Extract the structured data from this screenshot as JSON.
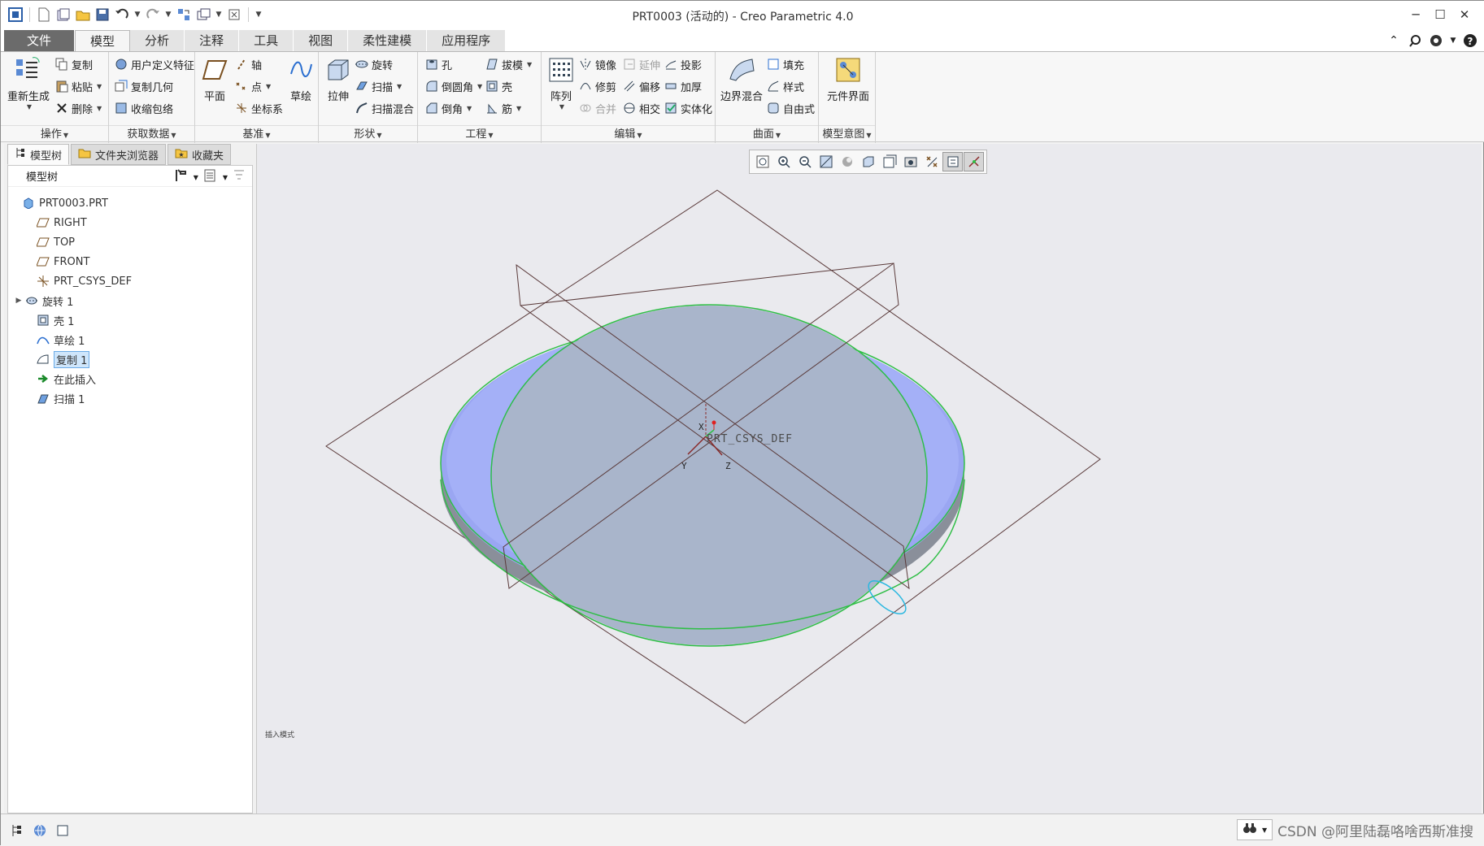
{
  "window": {
    "title": "PRT0003 (活动的) - Creo Parametric 4.0",
    "controls": [
      "minimize-icon",
      "maximize-icon",
      "close-icon"
    ]
  },
  "quick_access": [
    "app-logo-icon",
    "new-icon",
    "open-folder-icon",
    "open-icon",
    "save-icon",
    "undo-icon",
    "redo-icon",
    "regenerate-icon",
    "windows-icon",
    "close-window-icon",
    "customize-icon"
  ],
  "tabs": [
    {
      "label": "文件"
    },
    {
      "label": "模型"
    },
    {
      "label": "分析"
    },
    {
      "label": "注释"
    },
    {
      "label": "工具"
    },
    {
      "label": "视图"
    },
    {
      "label": "柔性建模"
    },
    {
      "label": "应用程序"
    }
  ],
  "ribbon": {
    "operations": {
      "footer": "操作",
      "regenerate": "重新生成",
      "copy": "复制",
      "paste": "粘贴",
      "delete": "删除"
    },
    "get_data": {
      "footer": "获取数据",
      "udf": "用户定义特征",
      "copy_geom": "复制几何",
      "shrinkwrap": "收缩包络"
    },
    "datum": {
      "footer": "基准",
      "plane": "平面",
      "axis": "轴",
      "point": "点",
      "csys": "坐标系",
      "sketch": "草绘"
    },
    "shapes": {
      "footer": "形状",
      "extrude": "拉伸",
      "revolve": "旋转",
      "sweep": "扫描",
      "swept_blend": "扫描混合"
    },
    "engineering": {
      "footer": "工程",
      "hole": "孔",
      "round": "倒圆角",
      "chamfer": "倒角",
      "draft": "拔模",
      "shell": "壳",
      "rib": "筋"
    },
    "editing": {
      "footer": "编辑",
      "pattern": "阵列",
      "mirror": "镜像",
      "extend": "延伸",
      "project": "投影",
      "trim": "修剪",
      "offset": "偏移",
      "thicken": "加厚",
      "merge": "合并",
      "intersect": "相交",
      "solidify": "实体化"
    },
    "surfaces": {
      "footer": "曲面",
      "boundary_blend": "边界混合",
      "fill": "填充",
      "style": "样式",
      "freestyle": "自由式"
    },
    "model_intent": {
      "footer": "模型意图",
      "component_interface": "元件界面"
    }
  },
  "panel": {
    "tabs": [
      {
        "label": "模型树"
      },
      {
        "label": "文件夹浏览器"
      },
      {
        "label": "收藏夹"
      }
    ],
    "tree_header": "模型树",
    "items": [
      {
        "label": "PRT0003.PRT",
        "icon": "part-icon",
        "indent": 0
      },
      {
        "label": "RIGHT",
        "icon": "datum-plane-icon",
        "indent": 1
      },
      {
        "label": "TOP",
        "icon": "datum-plane-icon",
        "indent": 1
      },
      {
        "label": "FRONT",
        "icon": "datum-plane-icon",
        "indent": 1
      },
      {
        "label": "PRT_CSYS_DEF",
        "icon": "csys-icon",
        "indent": 1
      },
      {
        "label": "旋转 1",
        "icon": "revolve-icon",
        "indent": 1
      },
      {
        "label": "壳 1",
        "icon": "shell-icon",
        "indent": 1
      },
      {
        "label": "草绘 1",
        "icon": "sketch-icon",
        "indent": 1
      },
      {
        "label": "复制 1",
        "icon": "copy-surface-icon",
        "indent": 1
      },
      {
        "label": "在此插入",
        "icon": "insert-here-icon",
        "indent": 1
      },
      {
        "label": "扫描 1",
        "icon": "sweep-icon",
        "indent": 1
      }
    ]
  },
  "graphics": {
    "csys_label": "PRT_CSYS_DEF",
    "axis_x": "X",
    "axis_y": "Y",
    "axis_z": "Z",
    "insert_mode": "插入模式",
    "toolbar": [
      "refit-icon",
      "zoom-in-icon",
      "zoom-out-icon",
      "repaint-icon",
      "display-style-icon",
      "saved-views-icon",
      "view-manager-icon",
      "perspective-icon",
      "datum-display-icon",
      "annotation-display-icon",
      "spin-center-icon"
    ]
  },
  "statusbar": {
    "watermark": "CSDN @阿里陆磊咯啥西斯准搜"
  },
  "colors": {
    "part_blue": "#9aa6f2",
    "part_floor": "#a9b5cb",
    "edge_green": "#2fbe46",
    "datum_line": "#5a3a3a",
    "file_tab": "#6b6b6b"
  }
}
